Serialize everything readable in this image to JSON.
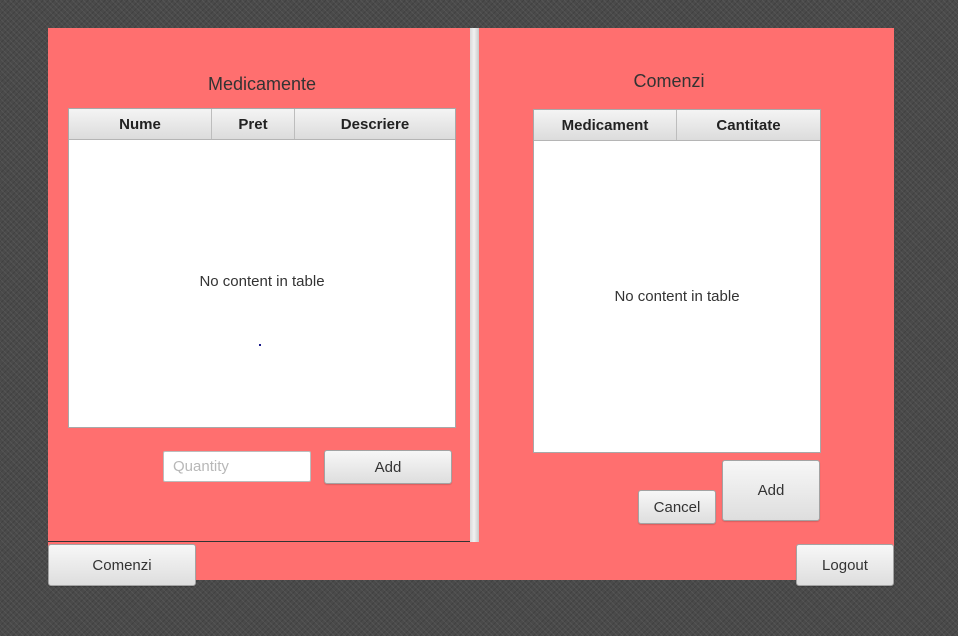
{
  "medicamente": {
    "title": "Medicamente",
    "columns": [
      "Nume",
      "Pret",
      "Descriere"
    ],
    "empty_message": "No content in table",
    "quantity_placeholder": "Quantity",
    "add_label": "Add"
  },
  "comenzi": {
    "title": "Comenzi",
    "columns": [
      "Medicament",
      "Cantitate"
    ],
    "empty_message": "No content in table",
    "cancel_label": "Cancel",
    "add_label": "Add"
  },
  "bottom_bar": {
    "comenzi_label": "Comenzi",
    "logout_label": "Logout"
  },
  "colors": {
    "panel_background": "#ff6f6f",
    "app_background": "#4a4a4a"
  }
}
